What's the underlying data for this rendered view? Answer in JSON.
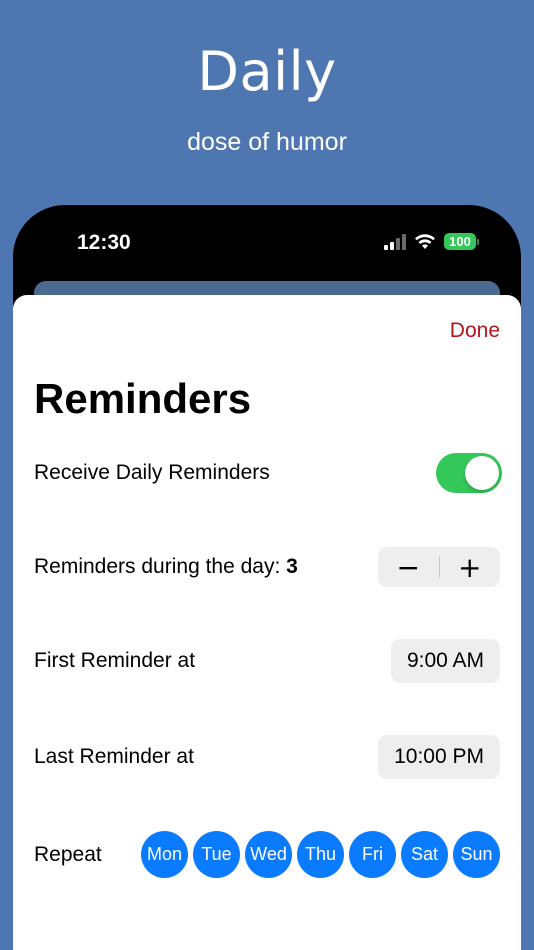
{
  "hero": {
    "title": "Daily",
    "subtitle": "dose of humor"
  },
  "status_bar": {
    "time": "12:30",
    "battery": "100",
    "icons": [
      "signal-icon",
      "wifi-icon",
      "battery-icon"
    ]
  },
  "sheet": {
    "done_label": "Done",
    "title": "Reminders",
    "daily_reminders": {
      "label": "Receive Daily Reminders",
      "enabled": true
    },
    "reminders_count": {
      "label": "Reminders during the day:",
      "value": "3",
      "minus": "−",
      "plus": "+"
    },
    "first_reminder": {
      "label": "First Reminder at",
      "value": "9:00 AM"
    },
    "last_reminder": {
      "label": "Last Reminder at",
      "value": "10:00 PM"
    },
    "repeat": {
      "label": "Repeat",
      "days": [
        "Mon",
        "Tue",
        "Wed",
        "Thu",
        "Fri",
        "Sat",
        "Sun"
      ]
    }
  },
  "colors": {
    "background": "#4e76b0",
    "accent_done": "#b3141a",
    "toggle_on": "#34c759",
    "day_selected": "#0a7aff"
  }
}
